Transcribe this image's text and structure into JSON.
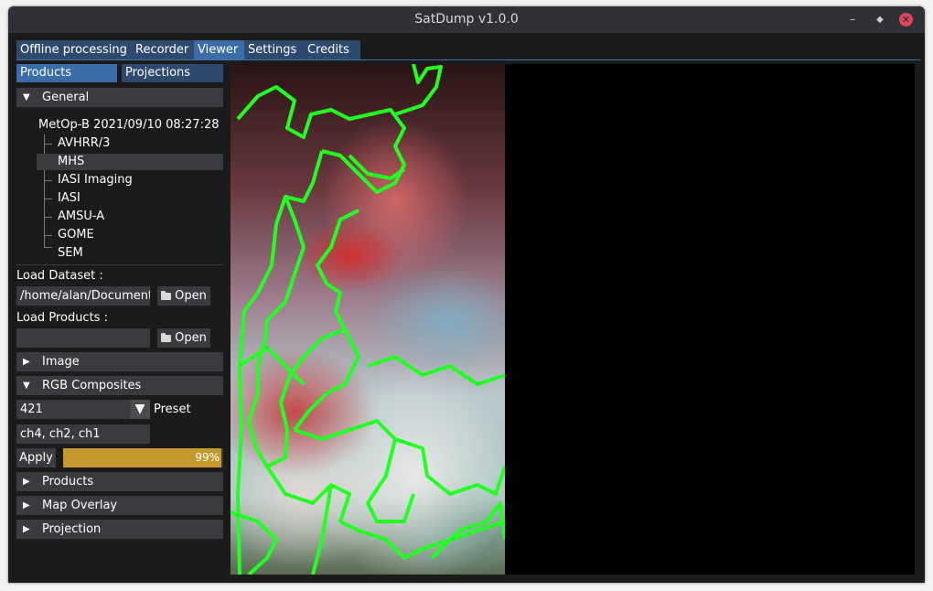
{
  "window": {
    "title": "SatDump v1.0.0",
    "min": "–",
    "max": "◆",
    "close": "✕"
  },
  "main_tabs": [
    "Offline processing",
    "Recorder",
    "Viewer",
    "Settings",
    "Credits"
  ],
  "sub_tabs": [
    "Products",
    "Projections"
  ],
  "general": {
    "label": "General",
    "dataset_name": "MetOp-B 2021/09/10 08:27:28",
    "products": [
      "AVHRR/3",
      "MHS",
      "IASI Imaging",
      "IASI",
      "AMSU-A",
      "GOME",
      "SEM"
    ],
    "selected": "MHS"
  },
  "load_dataset": {
    "label": "Load Dataset :",
    "value": "/home/alan/Documents",
    "open": "Open"
  },
  "load_products": {
    "label": "Load Products :",
    "value": "",
    "open": "Open"
  },
  "sections": {
    "image": "Image",
    "rgb": "RGB Composites",
    "products": "Products",
    "map_overlay": "Map Overlay",
    "projection": "Projection"
  },
  "rgb": {
    "preset_value": "421",
    "preset_label": "Preset",
    "expression": "ch4, ch2, ch1",
    "apply": "Apply",
    "progress": 0.99,
    "progress_label": "99%"
  },
  "icons": {
    "expanded": "triangle-down",
    "collapsed": "triangle-right",
    "folder": "folder-icon"
  },
  "colors": {
    "accent": "#3a6da8",
    "progress": "#c49a2e",
    "overlay": "#22ff22"
  }
}
